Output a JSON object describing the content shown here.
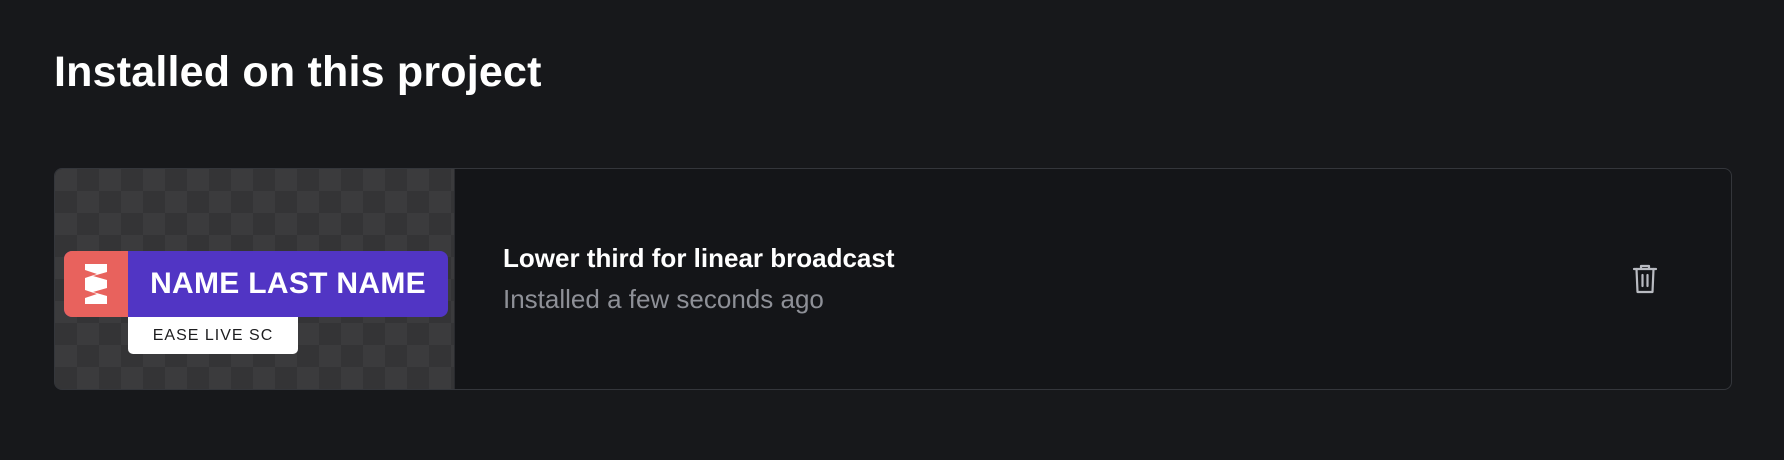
{
  "section": {
    "title": "Installed on this project"
  },
  "installed_items": [
    {
      "thumbnail": {
        "name_text": "NAME LAST NAME",
        "sub_text": "EASE LIVE SC",
        "logo_icon": "ease-live-logo-icon",
        "bar_color": "#5135c4",
        "logo_color": "#e8625d"
      },
      "title": "Lower third for linear broadcast",
      "status": "Installed a few seconds ago",
      "delete_icon": "trash-icon"
    }
  ],
  "colors": {
    "background": "#17181b",
    "card_border": "#34363b",
    "muted_text": "#8e9097"
  }
}
